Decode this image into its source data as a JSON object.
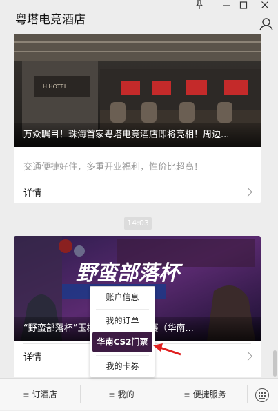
{
  "window": {
    "title": "粤塔电竞酒店",
    "controls": [
      "pin-icon",
      "minimize-icon",
      "maximize-icon",
      "close-icon"
    ]
  },
  "feed": {
    "card1": {
      "banner_title": "万众瞩目！珠海首家粤塔电竞酒店即将亮相！周边...",
      "banner_sign": "H HOTEL",
      "description": "交通便捷好住，多重开业福利，性价比超高！",
      "detail_label": "详情"
    },
    "timestamp": "14:03",
    "card2": {
      "banner_title": "“野蛮部落杯”玉树珠海届高校联赛（华南...",
      "banner_headline": "野蛮部落杯",
      "detail_label": "详情"
    }
  },
  "popup_menu": {
    "items": [
      {
        "label": "账户信息"
      },
      {
        "label": "我的订单"
      },
      {
        "label": "华南CS2门票"
      },
      {
        "label": "我的卡券"
      }
    ],
    "highlighted": "华南CS2门票"
  },
  "bottom_menu": {
    "items": [
      {
        "label": "订酒店"
      },
      {
        "label": "我的"
      },
      {
        "label": "便捷服务"
      }
    ],
    "keyboard_icon": "keyboard-icon"
  },
  "colors": {
    "background": "#ededed",
    "highlight": "#3d1b43",
    "annotation_arrow": "#e02020"
  }
}
